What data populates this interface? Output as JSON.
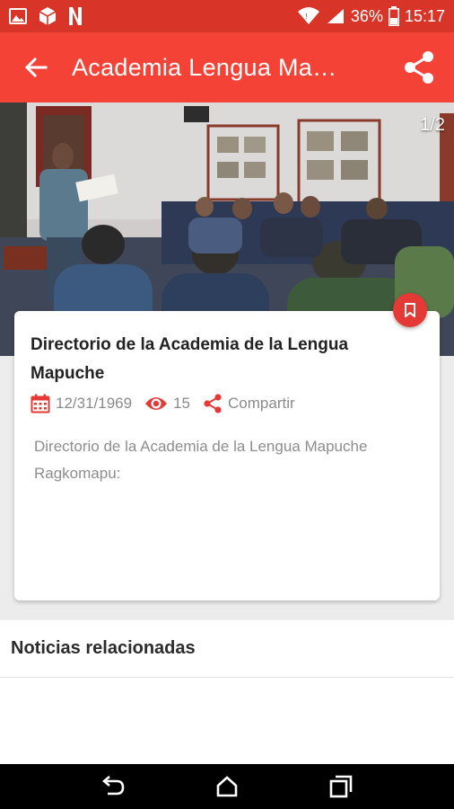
{
  "status_bar": {
    "battery": "36%",
    "time": "15:17",
    "left_icons": [
      "image-icon",
      "box-icon",
      "netflix-icon"
    ]
  },
  "app_bar": {
    "title": "Academia Lengua Mapuche"
  },
  "gallery": {
    "counter": "1/2"
  },
  "article": {
    "headline": "Directorio de la Academia de la Lengua Mapuche",
    "date": "12/31/1969",
    "views": "15",
    "share_label": "Compartir",
    "excerpt": "Directorio de la Academia de la Lengua Mapuche Ragkomapu:"
  },
  "related": {
    "heading": "Noticias relacionadas"
  },
  "colors": {
    "primary": "#f44336",
    "status": "#d83528",
    "accent_icon": "#e53935"
  }
}
